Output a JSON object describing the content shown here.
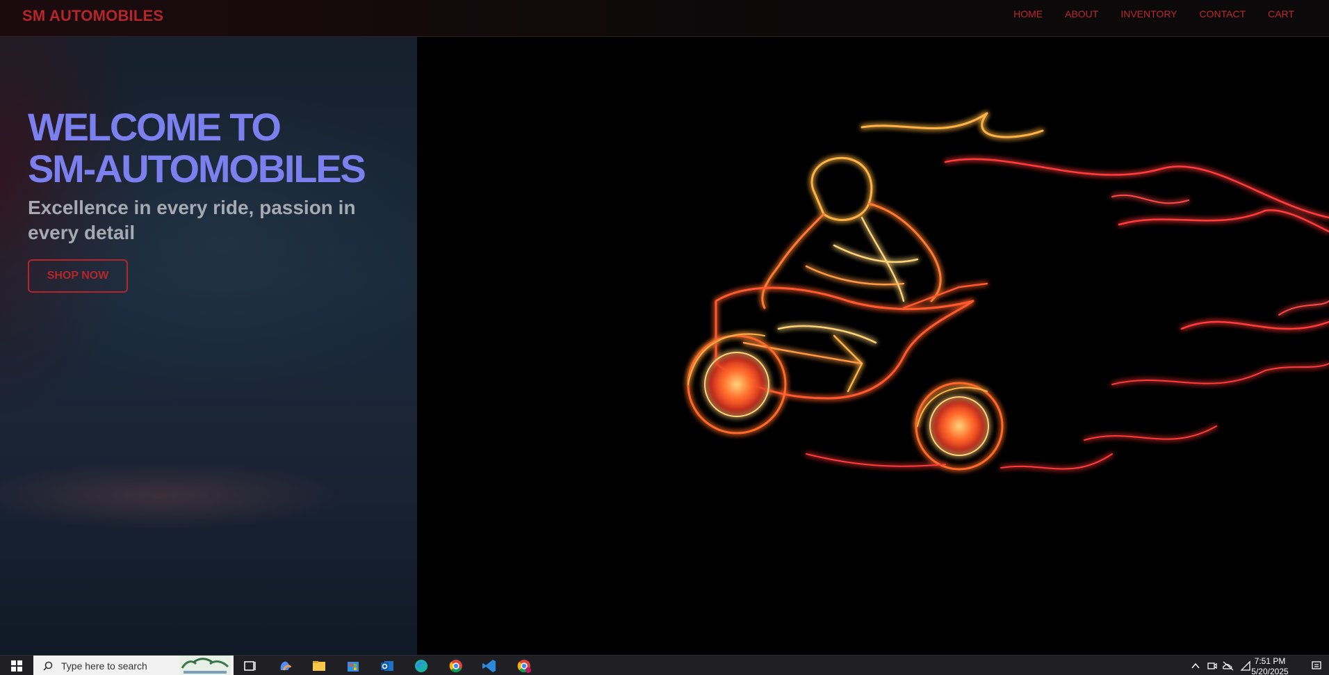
{
  "navbar": {
    "brand": "SM AUTOMOBILES",
    "links": [
      "HOME",
      "ABOUT",
      "INVENTORY",
      "CONTACT",
      "CART"
    ]
  },
  "hero": {
    "title_line1": "WELCOME TO",
    "title_line2": "SM-AUTOMOBILES",
    "subtitle": "Excellence in every ride, passion in every detail",
    "cta_label": "SHOP NOW",
    "image_icon": "neon-motorcycle-rider-illustration"
  },
  "taskbar": {
    "search_placeholder": "Type here to search",
    "pinned_apps": [
      "task-view-icon",
      "copilot-icon",
      "file-explorer-icon",
      "store-icon",
      "outlook-icon",
      "edge-icon",
      "chrome-icon",
      "vscode-icon",
      "chrome-profile-icon"
    ],
    "time": "7:51 PM",
    "date": "5/20/2025"
  },
  "colors": {
    "accent_red": "#b3262a",
    "title_purple": "#7b80ee",
    "subtitle_gray": "#a5a9b2"
  }
}
